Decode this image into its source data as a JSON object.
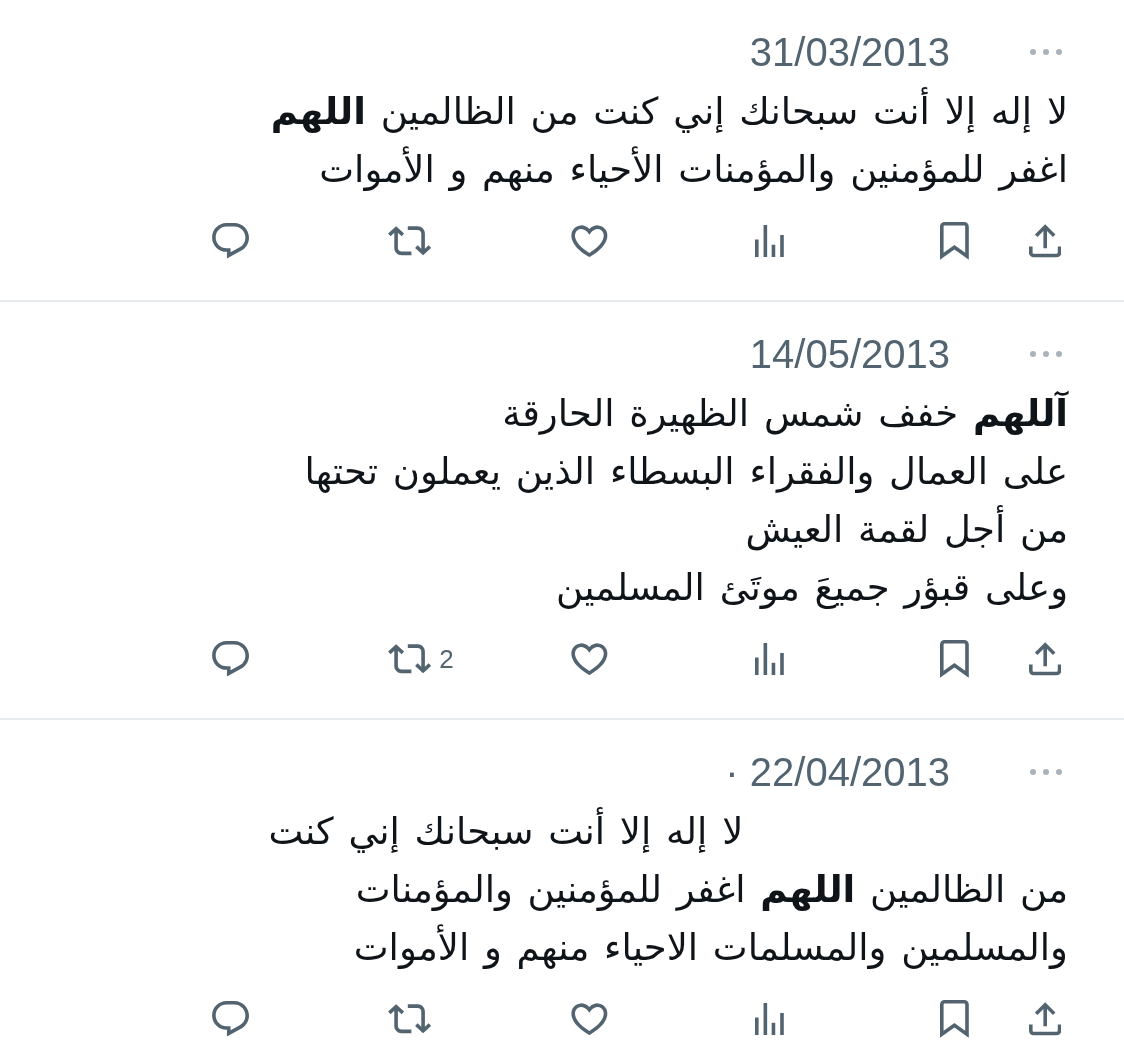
{
  "tweets": [
    {
      "date": "31/03/2013",
      "text": "لا إله إلا أنت سبحانك إني كنت من الظالمين **اللهم**\nاغفر للمؤمنين والمؤمنات الأحياء منهم و الأموات",
      "actions": [
        {
          "kind": "reply"
        },
        {
          "kind": "retweet"
        },
        {
          "kind": "like"
        },
        {
          "kind": "views"
        },
        {
          "kind": "bookmark"
        },
        {
          "kind": "share"
        }
      ]
    },
    {
      "date": "14/05/2013",
      "text": "**آللهم** خفف شمس الظهيرة الحارقة\nعلى العمال والفقراء البسطاء الذين يعملون تحتها\nمن أجل لقمة العيش\nوعلى قبؤر جميعَ موتَئ المسلمين",
      "actions": [
        {
          "kind": "reply"
        },
        {
          "kind": "retweet",
          "count": "2"
        },
        {
          "kind": "like"
        },
        {
          "kind": "views"
        },
        {
          "kind": "bookmark"
        },
        {
          "kind": "share"
        }
      ]
    },
    {
      "date": "· 22/04/2013",
      "text": "                      لا إله إلا أنت سبحانك إني كنت\nمن الظالمين **اللهم** اغفر للمؤمنين والمؤمنات\nوالمسلمين والمسلمات الاحياء منهم و الأموات",
      "actions": [
        {
          "kind": "reply"
        },
        {
          "kind": "retweet"
        },
        {
          "kind": "like"
        },
        {
          "kind": "views"
        },
        {
          "kind": "bookmark"
        },
        {
          "kind": "share"
        }
      ]
    }
  ]
}
